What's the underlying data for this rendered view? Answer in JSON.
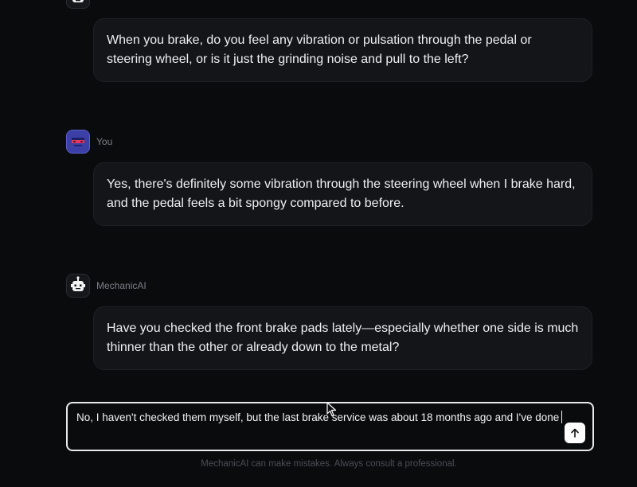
{
  "assistant_name": "MechanicAI",
  "user_name": "You",
  "messages": [
    {
      "role": "assistant",
      "text": "When you brake, do you feel any vibration or pulsation through the pedal or steering wheel, or is it just the grinding noise and pull to the left?"
    },
    {
      "role": "user",
      "text": "Yes, there's definitely some vibration through the steering wheel when I brake hard, and the pedal feels a bit spongy compared to before."
    },
    {
      "role": "assistant",
      "text": "Have you checked the front brake pads lately—especially whether one side is much thinner than the other or already down to the metal?"
    }
  ],
  "composer": {
    "value": "No, I haven't checked them myself, but the last brake service was about 18 months ago and I've done",
    "send_icon": "arrow-up-icon"
  },
  "disclaimer": "MechanicAI can make mistakes. Always consult a professional.",
  "colors": {
    "background": "#0a0b0d",
    "bubble": "#141518",
    "user_avatar": "#3b3fa6",
    "composer_border": "#e8e9eb"
  }
}
